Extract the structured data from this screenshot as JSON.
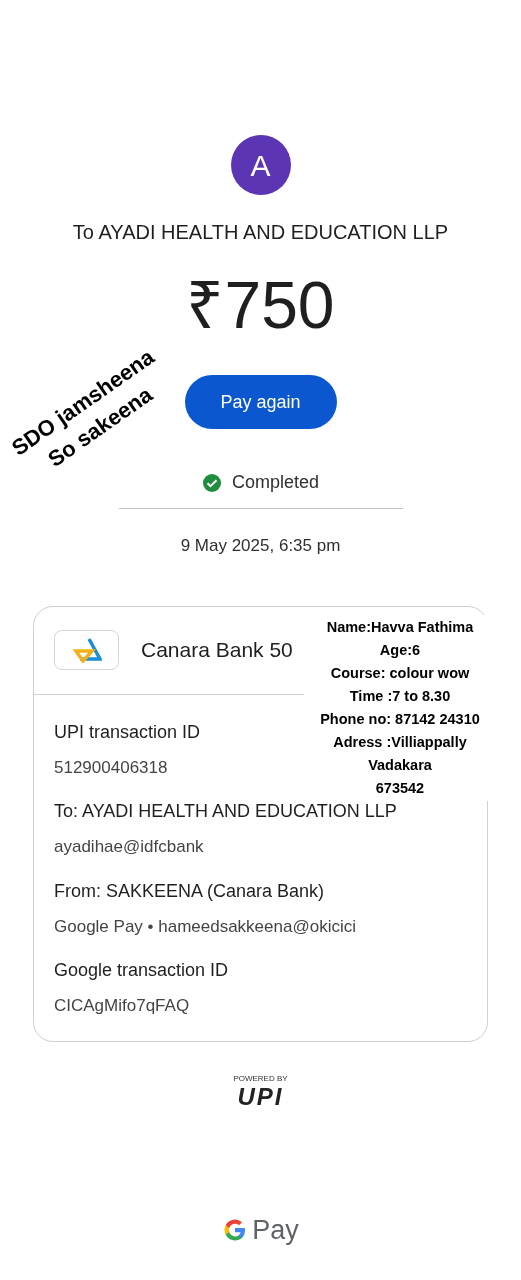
{
  "payee": {
    "avatar_letter": "A",
    "title": "To AYADI HEALTH AND EDUCATION LLP"
  },
  "amount": "₹750",
  "pay_again_button": "Pay again",
  "status": {
    "kind": "completed",
    "label": "Completed"
  },
  "date": "9 May 2025, 6:35 pm",
  "card": {
    "bank": "Canara Bank 50",
    "details": [
      {
        "label": "UPI transaction ID",
        "value": "512900406318"
      },
      {
        "label": "To: AYADI HEALTH AND EDUCATION LLP",
        "value": "ayadihae@idfcbank"
      },
      {
        "label": "From: SAKKEENA (Canara Bank)",
        "value": "Google Pay • hameedsakkeena@okicici"
      },
      {
        "label": "Google transaction ID",
        "value": "CICAgMifo7qFAQ"
      }
    ]
  },
  "upi_badge": {
    "caption": "POWERED BY",
    "logo": "UPI"
  },
  "footer_logo": "Pay",
  "annotations": {
    "diagonal_note": [
      "SDO jamsheena",
      "So sakeena"
    ],
    "student_note": [
      "Name:Havva Fathima",
      "Age:6",
      "Course: colour wow",
      "Time :7 to 8.30",
      "Phone no: 87142 24310",
      "Adress :Villiappally",
      "Vadakara",
      "673542"
    ]
  }
}
